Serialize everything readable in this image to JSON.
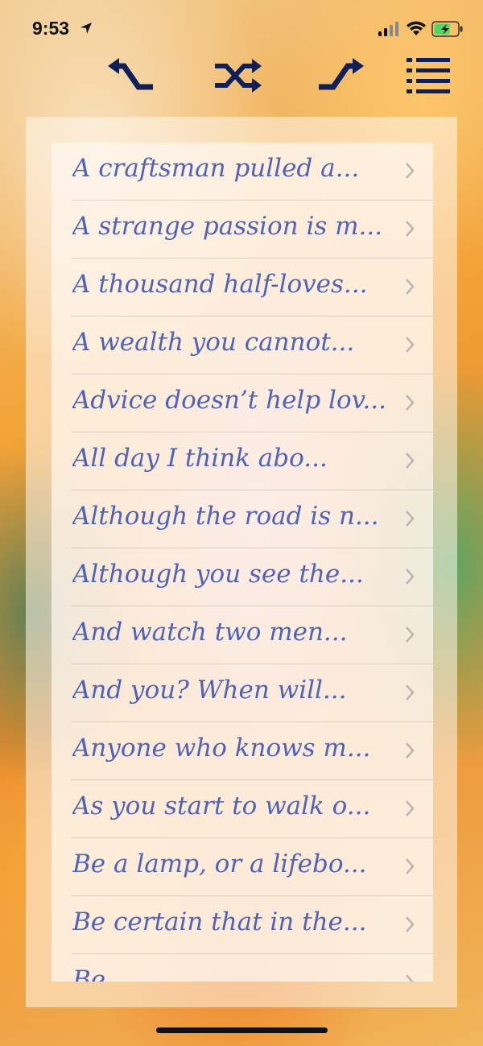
{
  "status_bar": {
    "time": "9:53"
  },
  "toolbar": {
    "buttons": [
      {
        "name": "previous-icon"
      },
      {
        "name": "shuffle-icon"
      },
      {
        "name": "next-icon"
      },
      {
        "name": "list-icon"
      }
    ],
    "icon_color": "#0f1f5a"
  },
  "list": {
    "text_color": "#4f63b8",
    "items": [
      "A craftsman pulled a...",
      "A strange passion is m...",
      "A thousand half-loves...",
      "A wealth you cannot...",
      "Advice doesn’t help lov...",
      "All day I think abo...",
      "Although the road is n...",
      "Although you see the...",
      "And watch two men...",
      "And you? When will...",
      "Anyone who knows m...",
      "As you start to walk o...",
      "Be a lamp, or a lifebo...",
      "Be certain that in the...",
      "Be ..."
    ]
  }
}
